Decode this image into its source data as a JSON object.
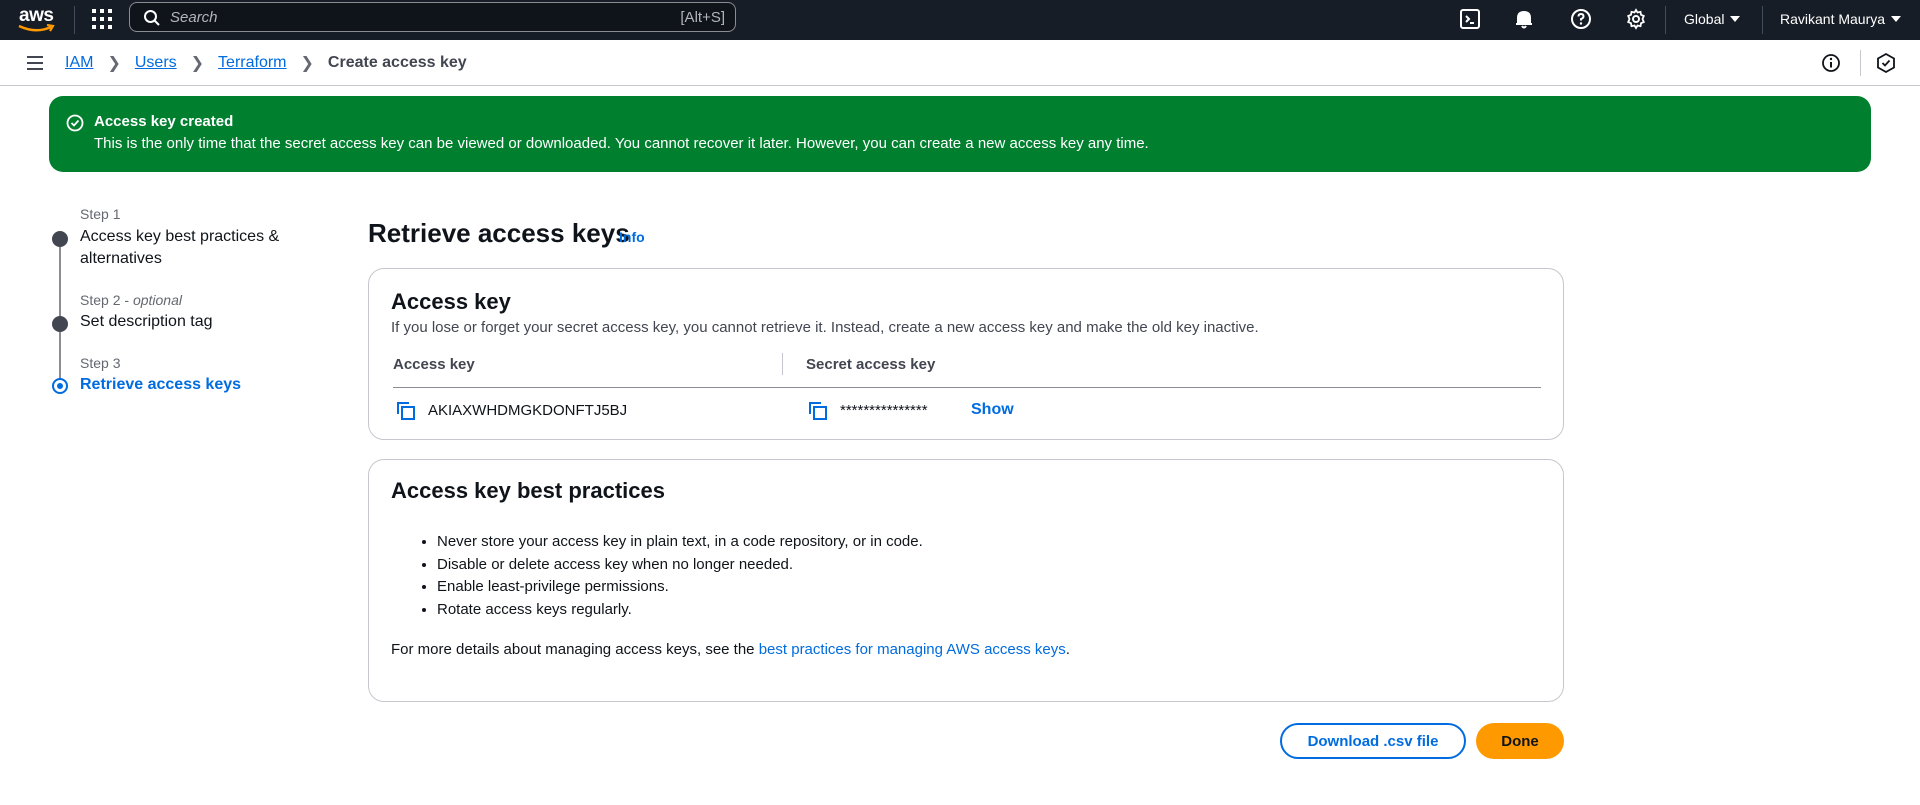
{
  "topnav": {
    "logo_text": "aws",
    "search": {
      "placeholder": "Search",
      "shortcut": "[Alt+S]"
    },
    "icons": [
      "cloudshell-icon",
      "bell-icon",
      "help-icon",
      "settings-icon"
    ],
    "region": "Global",
    "user": "Ravikant Maurya"
  },
  "breadcrumb": {
    "items": [
      "IAM",
      "Users",
      "Terraform"
    ],
    "current": "Create access key"
  },
  "flash": {
    "title": "Access key created",
    "message": "This is the only time that the secret access key can be viewed or downloaded. You cannot recover it later. However, you can create a new access key any time.",
    "color": "#00802f"
  },
  "steps": [
    {
      "number": "Step 1",
      "optional": "",
      "label": "Access key best practices & alternatives"
    },
    {
      "number": "Step 2",
      "optional": "optional",
      "label": "Set description tag"
    },
    {
      "number": "Step 3",
      "optional": "",
      "label": "Retrieve access keys"
    }
  ],
  "page": {
    "title": "Retrieve access keys",
    "info_link": "Info"
  },
  "access_key_card": {
    "title": "Access key",
    "description": "If you lose or forget your secret access key, you cannot retrieve it. Instead, create a new access key and make the old key inactive.",
    "columns": [
      "Access key",
      "Secret access key"
    ],
    "access_key_value": "AKIAXWHDMGKDONFTJ5BJ",
    "secret_value": "***************",
    "show_label": "Show"
  },
  "best_practices_card": {
    "title": "Access key best practices",
    "items": [
      "Never store your access key in plain text, in a code repository, or in code.",
      "Disable or delete access key when no longer needed.",
      "Enable least-privilege permissions.",
      "Rotate access keys regularly."
    ],
    "more_prefix": "For more details about managing access keys, see the ",
    "more_link": "best practices for managing AWS access keys",
    "more_suffix": "."
  },
  "actions": {
    "download_label": "Download .csv file",
    "done_label": "Done"
  },
  "colors": {
    "accent": "#006ce0",
    "primary_button": "#ff9900",
    "nav_bg": "#161d26"
  }
}
